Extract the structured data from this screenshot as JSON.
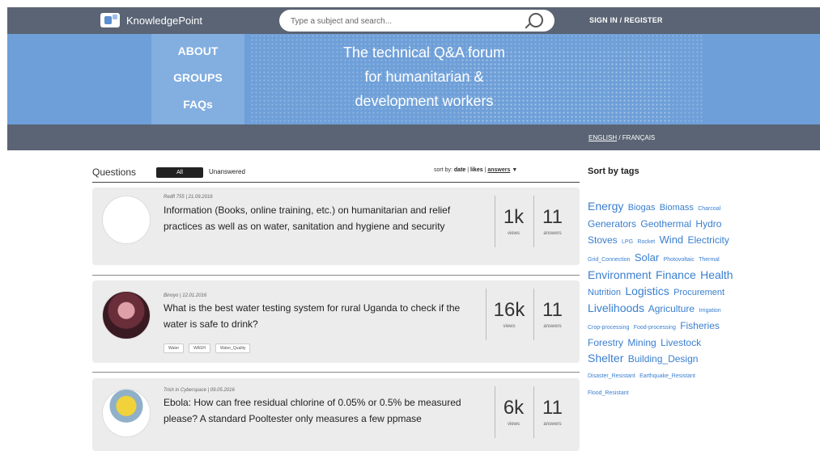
{
  "header": {
    "brand": "KnowledgePoint",
    "search_placeholder": "Type a subject and search...",
    "signin": "SIGN IN / REGISTER"
  },
  "hero": {
    "nav": [
      "ABOUT",
      "GROUPS",
      "FAQs"
    ],
    "tagline": [
      "The technical Q&A forum",
      "for humanitarian &",
      "development workers"
    ]
  },
  "lang": {
    "en": "ENGLISH",
    "sep": " / ",
    "fr": "FRANÇAIS"
  },
  "questions": {
    "title": "Questions",
    "tab_all": "All",
    "tab_unanswered": "Unanswered",
    "sort_prefix": "sort by: ",
    "sort_date": "date",
    "sort_likes": "likes",
    "sort_answers": "answers",
    "sort_arrow": "▼",
    "items": [
      {
        "meta": "Redfl 755 | 21.09.2016",
        "text": "Information (Books, online training, etc.) on humanitarian and relief practices as well as on water, sanitation and hygiene and security",
        "views": "1k",
        "views_label": "views",
        "answers": "11",
        "answers_label": "answers",
        "tags": []
      },
      {
        "meta": "Binoyo | 12.01.2016",
        "text": "What is the best water testing system for rural Uganda to check if the water is safe to drink?",
        "views": "16k",
        "views_label": "views",
        "answers": "11",
        "answers_label": "answers",
        "tags": [
          "Water",
          "WASH",
          "Water_Quality"
        ]
      },
      {
        "meta": "Trish in Cyberspace | 09.05.2016",
        "text": "Ebola: How can free residual chlorine of 0.05% or 0.5% be measured please? A standard Pooltester only measures a few ppmase",
        "views": "6k",
        "views_label": "views",
        "answers": "11",
        "answers_label": "answers",
        "tags": []
      }
    ]
  },
  "sidebar": {
    "title": "Sort by tags",
    "tags": [
      {
        "t": "Energy",
        "s": 14
      },
      {
        "t": "Biogas",
        "s": 11
      },
      {
        "t": "Biomass",
        "s": 11
      },
      {
        "t": "Charcoal",
        "s": 7
      },
      {
        "t": "Generators",
        "s": 12
      },
      {
        "t": "Geothermal",
        "s": 12
      },
      {
        "t": "Hydro",
        "s": 12
      },
      {
        "t": "Stoves",
        "s": 12
      },
      {
        "t": "LPG",
        "s": 7
      },
      {
        "t": "Rocket",
        "s": 7
      },
      {
        "t": "Wind",
        "s": 13
      },
      {
        "t": "Electricity",
        "s": 12
      },
      {
        "t": "Grid_Connection",
        "s": 7
      },
      {
        "t": "Solar",
        "s": 13
      },
      {
        "t": "Photovoltaic",
        "s": 7
      },
      {
        "t": "Thermal",
        "s": 7
      },
      {
        "t": "Environment",
        "s": 14
      },
      {
        "t": "Finance",
        "s": 14
      },
      {
        "t": "Health",
        "s": 14
      },
      {
        "t": "Nutrition",
        "s": 11
      },
      {
        "t": "Logistics",
        "s": 14
      },
      {
        "t": "Procurement",
        "s": 11
      },
      {
        "t": "Livelihoods",
        "s": 14
      },
      {
        "t": "Agriculture",
        "s": 12
      },
      {
        "t": "Irrigation",
        "s": 7
      },
      {
        "t": "Crop-processing",
        "s": 7
      },
      {
        "t": "Food-processing",
        "s": 7
      },
      {
        "t": "Fisheries",
        "s": 12
      },
      {
        "t": "Forestry",
        "s": 12
      },
      {
        "t": "Mining",
        "s": 12
      },
      {
        "t": "Livestock",
        "s": 12
      },
      {
        "t": "Shelter",
        "s": 14
      },
      {
        "t": "Building_Design",
        "s": 12
      },
      {
        "t": "Disaster_Resistant",
        "s": 7
      },
      {
        "t": "Earthquake_Resistant",
        "s": 7
      },
      {
        "t": "Flood_Resistant",
        "s": 7
      }
    ]
  },
  "colors": {
    "header_bg": "#5a6474",
    "hero_bg": "#6e9fd8",
    "tag_blue": "#3a7fcf"
  }
}
